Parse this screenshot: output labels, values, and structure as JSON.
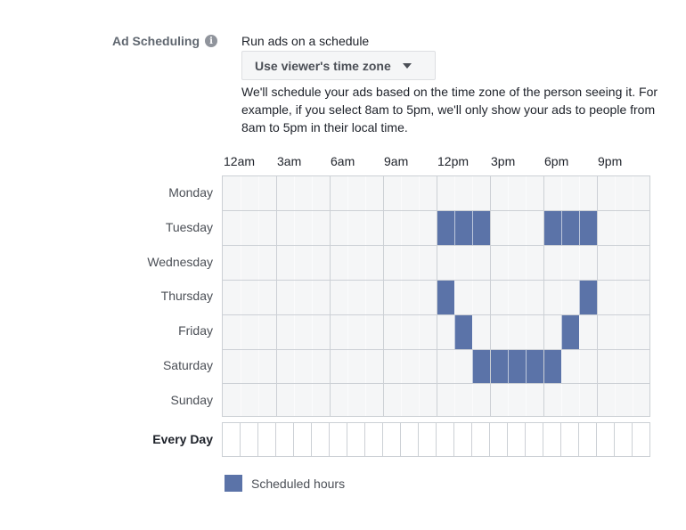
{
  "section": {
    "label": "Ad Scheduling",
    "info_icon": "info-icon",
    "run_text": "Run ads on a schedule",
    "timezone_dropdown": {
      "selected": "Use viewer's time zone",
      "icon": "caret-down-icon"
    },
    "description": "We'll schedule your ads based on the time zone of the person seeing it. For example, if you select 8am to 5pm, we'll only show your ads to people from 8am to 5pm in their local time."
  },
  "schedule": {
    "hour_labels": [
      "12am",
      "3am",
      "6am",
      "9am",
      "12pm",
      "3pm",
      "6pm",
      "9pm"
    ],
    "hours_per_day": 24,
    "days": [
      {
        "name": "Monday",
        "scheduled_hours": []
      },
      {
        "name": "Tuesday",
        "scheduled_hours": [
          12,
          13,
          14,
          18,
          19,
          20
        ]
      },
      {
        "name": "Wednesday",
        "scheduled_hours": []
      },
      {
        "name": "Thursday",
        "scheduled_hours": [
          12,
          20
        ]
      },
      {
        "name": "Friday",
        "scheduled_hours": [
          13,
          19
        ]
      },
      {
        "name": "Saturday",
        "scheduled_hours": [
          14,
          15,
          16,
          17,
          18
        ]
      },
      {
        "name": "Sunday",
        "scheduled_hours": []
      }
    ],
    "every_day_label": "Every Day",
    "scheduled_color": "#5b73a8"
  },
  "legend": {
    "label": "Scheduled hours",
    "color": "#5b73a8"
  }
}
